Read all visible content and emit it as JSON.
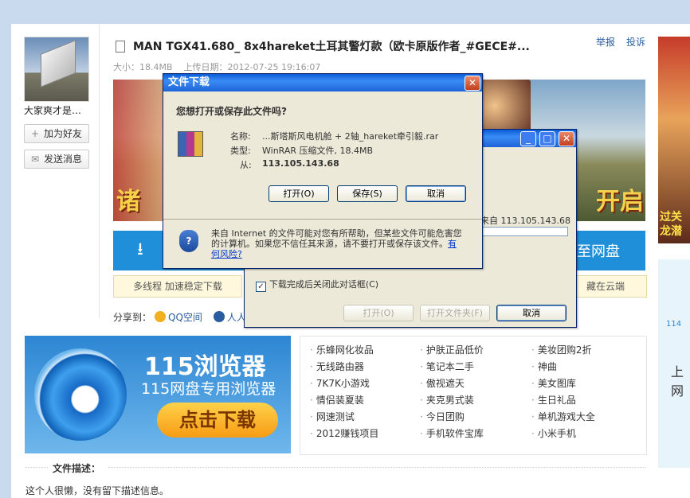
{
  "user": {
    "name": "大家爽才是…",
    "add_friend": "加为好友",
    "send_msg": "发送消息"
  },
  "file": {
    "title": "MAN TGX41.680_ 8x4hareket土耳其警灯款（欧卡原版作者_#GECE#...",
    "report": "举报",
    "complain": "投诉",
    "size_label": "大小：18.4MB",
    "upload_label": "上传日期：2012-07-25 19:16:07"
  },
  "banner": {
    "left_text": "诸",
    "right_text": "开启"
  },
  "download": {
    "save_to_disk": "至网盘",
    "multithread": "多线程 加速稳定下载",
    "cloud": "藏在云端"
  },
  "share": {
    "label": "分享到：",
    "qq": "QQ空间",
    "renren": "人人"
  },
  "ad": {
    "line1": "115浏览器",
    "line2": "115网盘专用浏览器",
    "button": "点击下载"
  },
  "links": [
    [
      "乐蜂网化妆品",
      "护肤正品低价",
      "美妆团购2折"
    ],
    [
      "无线路由器",
      "笔记本二手",
      "神曲"
    ],
    [
      "7K7K小游戏",
      "傲视遮天",
      "美女图库"
    ],
    [
      "情侣装夏装",
      "夹克男式装",
      "生日礼品"
    ],
    [
      "网速测试",
      "今日团购",
      "单机游戏大全"
    ],
    [
      "2012赚钱项目",
      "手机软件宝库",
      "小米手机"
    ]
  ],
  "description": {
    "title": "文件描述：",
    "text": "这个人很懒，没有留下描述信息。"
  },
  "right_ads": {
    "top_text": "过关\n龙潜",
    "num": "114",
    "side": "上 网"
  },
  "dialog_download": {
    "title": "文件下载",
    "question": "您想打开或保存此文件吗?",
    "name_label": "名称:",
    "name_value": "...斯塔斯风电机舱 + 2轴_hareket牵引毅.rar",
    "type_label": "类型:",
    "type_value": "WinRAR 压缩文件, 18.4MB",
    "from_label": "从:",
    "from_value": "113.105.143.68",
    "open": "打开(O)",
    "save": "保存(S)",
    "cancel": "取消",
    "warning": "来自 Internet 的文件可能对您有所帮助，但某些文件可能危害您的计算机。如果您不信任其来源，请不要打开或保存该文件。",
    "risk_link": "有何风险?"
  },
  "dialog_progress": {
    "from_text": "来自 113.105.143.68",
    "checkbox": "下载完成后关闭此对话框(C)",
    "open": "打开(O)",
    "open_folder": "打开文件夹(F)",
    "cancel": "取消"
  }
}
